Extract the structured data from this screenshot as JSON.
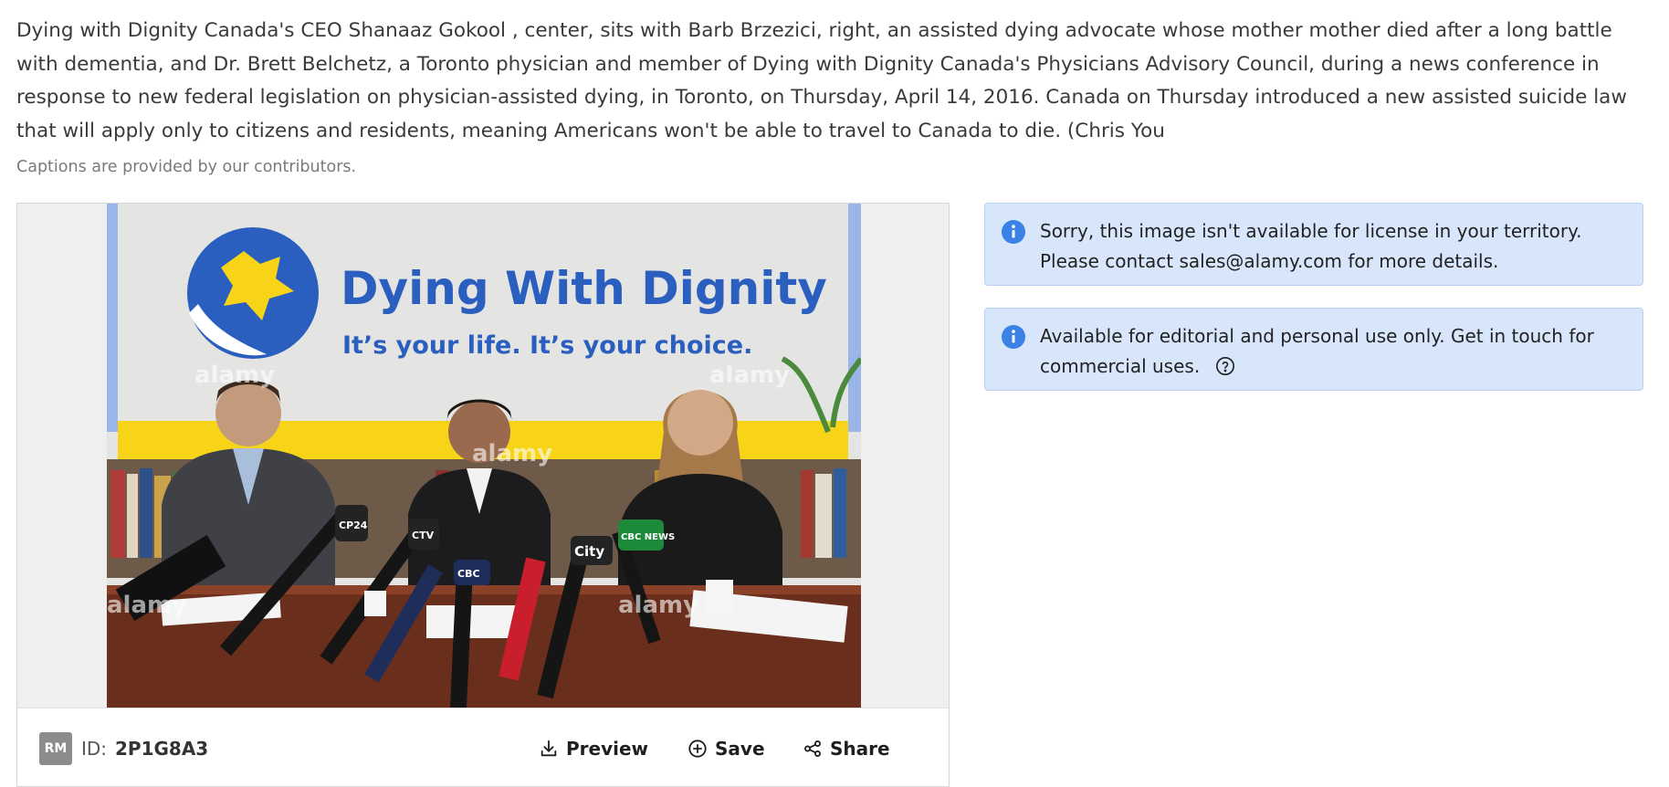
{
  "caption": {
    "text": "Dying with Dignity Canada's CEO Shanaaz Gokool , center, sits with Barb Brzezici, right, an assisted dying advocate whose mother mother died after a long battle with dementia, and Dr. Brett Belchetz, a Toronto physician and member of Dying with Dignity Canada's Physicians Advisory Council, during a news conference in response to new federal legislation on physician-assisted dying, in Toronto, on Thursday, April 14, 2016. Canada on Thursday introduced a new assisted suicide law that will apply only to citizens and residents, meaning Americans won't be able to travel to Canada to die. (Chris You",
    "note": "Captions are provided by our contributors."
  },
  "image": {
    "banner_title": "Dying With Dignity",
    "banner_subtitle": "It’s your life. It’s your choice.",
    "watermark": "alamy",
    "mic_labels": [
      "CP24",
      "CTV",
      "CBC",
      "City",
      "CBC NEWS"
    ]
  },
  "footer": {
    "badge": "RM",
    "id_label": "ID:",
    "id_value": "2P1G8A3",
    "preview_label": "Preview",
    "save_label": "Save",
    "share_label": "Share"
  },
  "notices": [
    {
      "icon": "info-icon",
      "line1": "Sorry, this image isn't available for license in your territory.",
      "line2": "Please contact sales@alamy.com for more details."
    },
    {
      "icon": "info-icon",
      "line1": "Available for editorial and personal use only. Get in touch for",
      "line2": "commercial uses.",
      "help_icon": "question-circle-icon"
    }
  ],
  "colors": {
    "notice_bg": "#d7e6fb",
    "notice_border": "#b9d1f2",
    "info_icon": "#3b82e6",
    "banner_blue": "#2a5fbf",
    "banner_yellow": "#f7d417"
  }
}
